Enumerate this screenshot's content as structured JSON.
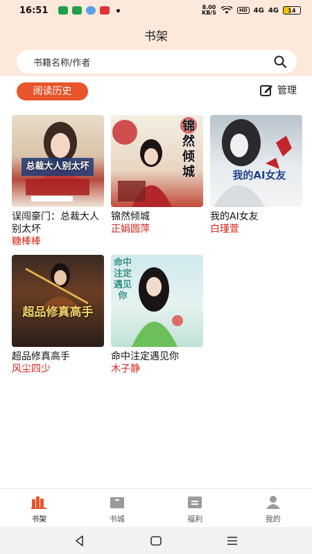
{
  "status_bar": {
    "time": "16:51",
    "net_speed_value": "8.00",
    "net_speed_unit": "KB/S",
    "hd_label": "HD",
    "signal_1": "4G",
    "signal_2": "4G",
    "battery": "14"
  },
  "header": {
    "title": "书架"
  },
  "search": {
    "placeholder": "书籍名称/作者"
  },
  "shelf": {
    "history_label": "阅读历史",
    "manage_label": "管理"
  },
  "books": [
    {
      "title": "误闯豪门：总裁大人别太坏",
      "author": "糖棒棒",
      "cover_text": "总裁大人别太坏"
    },
    {
      "title": "锦然倾城",
      "author": "正娟圆萍",
      "cover_text": "锦然倾城"
    },
    {
      "title": "我的AI女友",
      "author": "白瑾萱",
      "cover_text": "我的AI女友"
    },
    {
      "title": "超品修真高手",
      "author": "风尘四少",
      "cover_text": "超品修真高手"
    },
    {
      "title": "命中注定遇见你",
      "author": "木子静",
      "cover_text": "命中注定遇见你"
    }
  ],
  "bottom_nav": [
    {
      "label": "书架",
      "icon": "bookshelf-icon",
      "active": true
    },
    {
      "label": "书城",
      "icon": "bookstore-icon",
      "active": false
    },
    {
      "label": "福利",
      "icon": "gift-icon",
      "active": false
    },
    {
      "label": "我的",
      "icon": "profile-icon",
      "active": false
    }
  ],
  "colors": {
    "accent": "#e8542b",
    "author": "#d1251a",
    "header_bg": "#fde8dc"
  }
}
